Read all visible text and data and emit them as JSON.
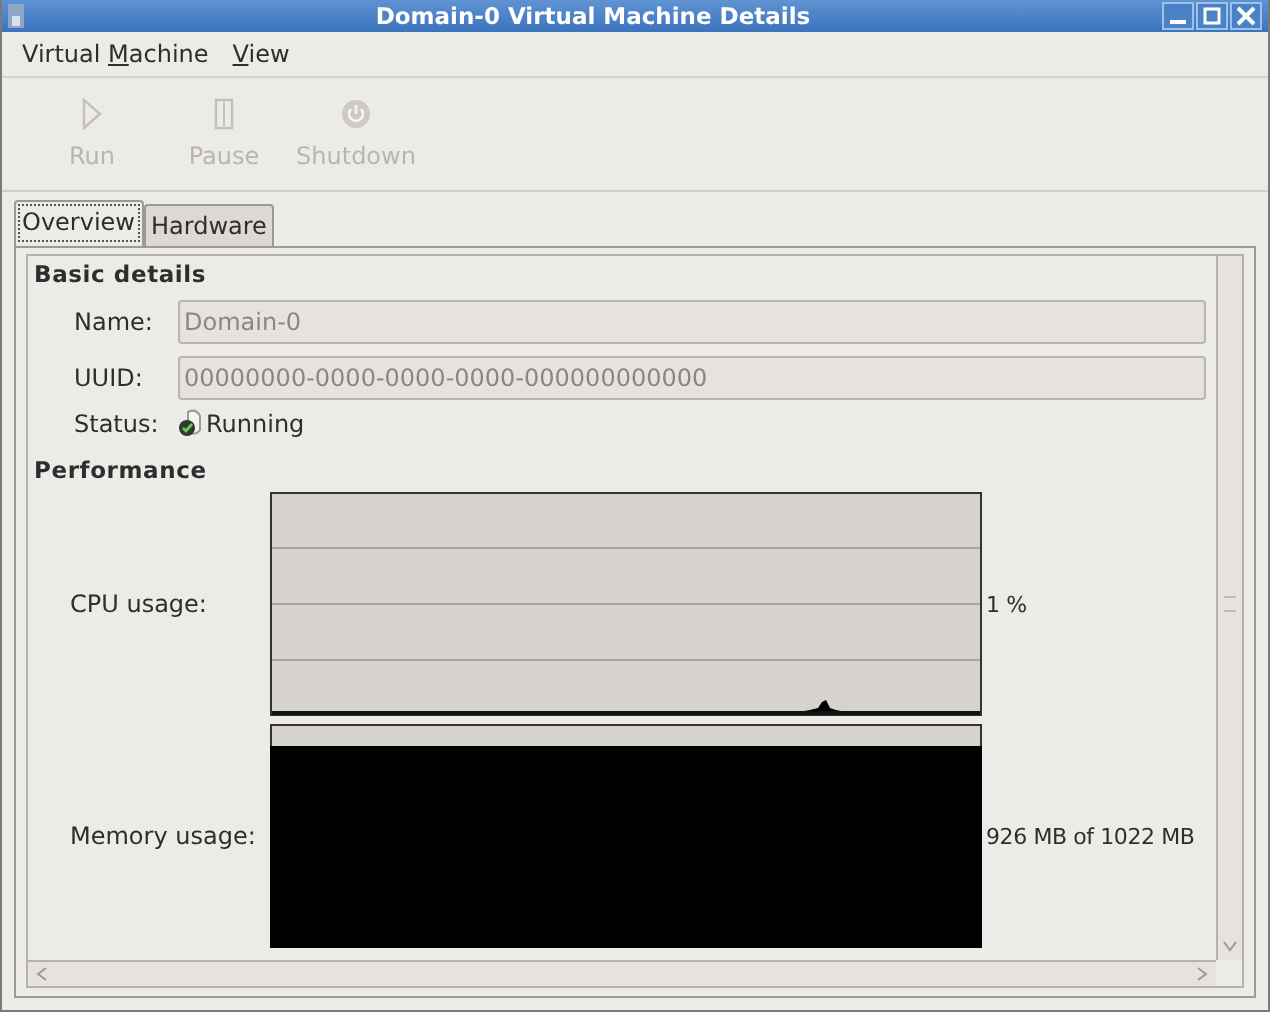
{
  "window": {
    "title": "Domain-0 Virtual Machine Details"
  },
  "menu": [
    {
      "before": "Virtual ",
      "mnemonic": "M",
      "after": "achine"
    },
    {
      "mnemonic": "V",
      "after": "iew"
    }
  ],
  "toolbar": [
    {
      "kind": "run",
      "label": "Run",
      "disabled": true
    },
    {
      "kind": "pause",
      "label": "Pause",
      "disabled": true
    },
    {
      "kind": "shutdown",
      "label": "Shutdown",
      "disabled": true
    }
  ],
  "tabs": [
    {
      "label": "Overview",
      "selected": true
    },
    {
      "label": "Hardware",
      "selected": false
    }
  ],
  "basic_details": {
    "heading": "Basic details",
    "fields": [
      {
        "label": "Name:",
        "value": "Domain-0",
        "disabled": true
      },
      {
        "label": "UUID:",
        "value": "00000000-0000-0000-0000-000000000000",
        "disabled": true
      }
    ],
    "status": {
      "label": "Status:",
      "value": "Running"
    }
  },
  "performance": {
    "heading": "Performance",
    "metrics": [
      {
        "kind": "cpu",
        "label": "CPU usage:",
        "reading": "1 %"
      },
      {
        "kind": "memory",
        "label": "Memory usage:",
        "reading": "926 MB of 1022 MB"
      }
    ]
  }
}
